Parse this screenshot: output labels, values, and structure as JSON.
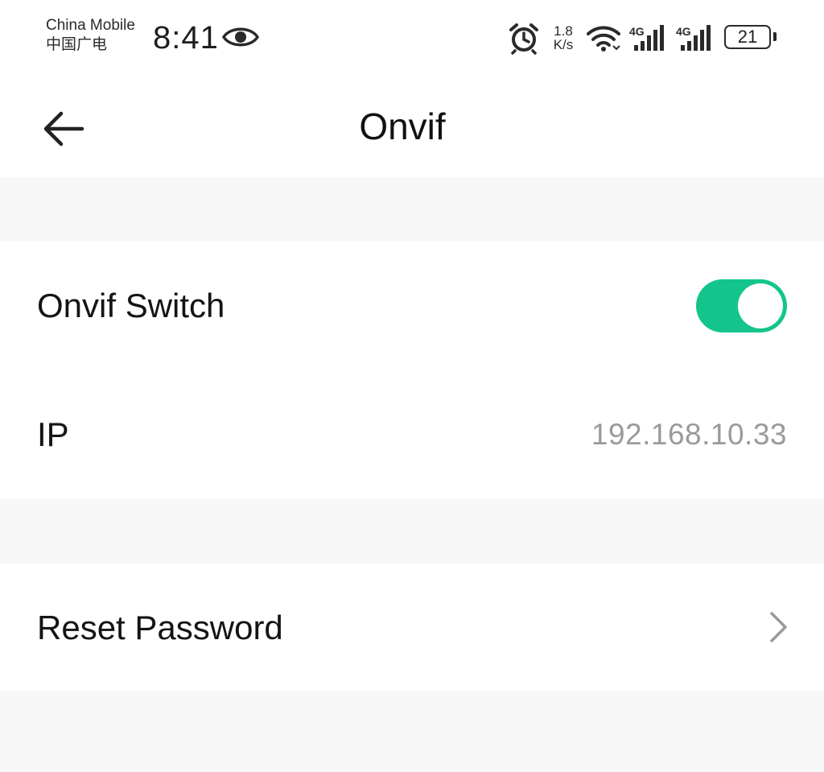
{
  "status_bar": {
    "carrier_primary": "China Mobile",
    "carrier_secondary": "中国广电",
    "time": "8:41",
    "net_speed_value": "1.8",
    "net_speed_unit": "K/s",
    "signal_1_label": "4G",
    "signal_2_label": "4G",
    "battery_level": "21",
    "icons": [
      "eye-icon",
      "alarm-icon",
      "wifi-icon",
      "signal-icon",
      "signal-icon",
      "battery-icon"
    ]
  },
  "header": {
    "title": "Onvif",
    "back_icon": "arrow-left-icon"
  },
  "settings": {
    "onvif_switch": {
      "label": "Onvif Switch",
      "enabled": true,
      "on_color": "#13c58c"
    },
    "ip": {
      "label": "IP",
      "value": "192.168.10.33"
    },
    "reset_password": {
      "label": "Reset Password",
      "icon": "chevron-right-icon"
    }
  },
  "colors": {
    "accent": "#13c58c",
    "background": "#f7f7f7",
    "surface": "#ffffff",
    "secondary_text": "#9a9a9a"
  }
}
